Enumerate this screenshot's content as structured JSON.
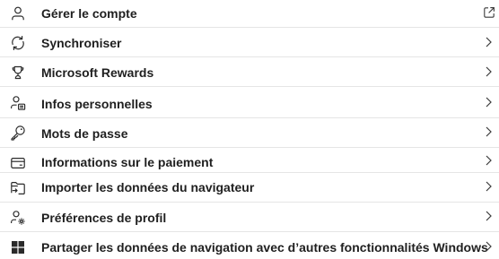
{
  "colors": {
    "text": "#1f1f1f",
    "icon": "#2b2b2b",
    "divider": "#e5e5e5",
    "chevron": "#3a3a3a"
  },
  "items": [
    {
      "label": "Gérer le compte",
      "icon": "person-icon",
      "trailing": "external-link-icon"
    },
    {
      "label": "Synchroniser",
      "icon": "sync-icon",
      "trailing": "chevron-right-icon"
    },
    {
      "label": "Microsoft Rewards",
      "icon": "trophy-icon",
      "trailing": "chevron-right-icon"
    },
    {
      "label": "Infos personnelles",
      "icon": "person-card-icon",
      "trailing": "chevron-right-icon"
    },
    {
      "label": "Mots de passe",
      "icon": "key-icon",
      "trailing": "chevron-right-icon"
    },
    {
      "label": "Informations sur le paiement",
      "icon": "credit-card-icon",
      "trailing": "chevron-right-icon"
    },
    {
      "label": "Importer les données du navigateur",
      "icon": "folder-import-icon",
      "trailing": "chevron-right-icon"
    },
    {
      "label": "Préférences de profil",
      "icon": "person-settings-icon",
      "trailing": "chevron-right-icon"
    },
    {
      "label": "Partager les données de navigation avec d’autres fonctionnalités Windows",
      "icon": "windows-icon",
      "trailing": "chevron-right-icon"
    }
  ]
}
